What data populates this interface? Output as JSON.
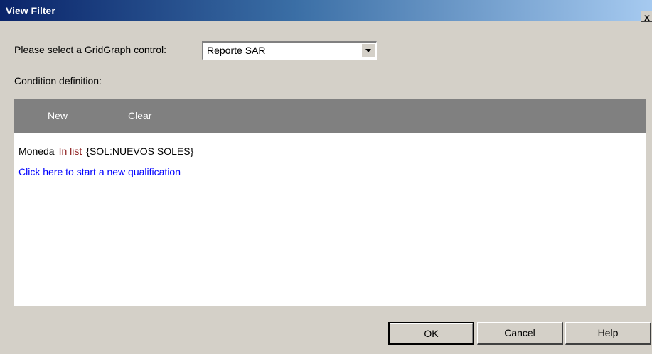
{
  "window": {
    "title": "View Filter",
    "close_symbol": "x"
  },
  "selector": {
    "label": "Please select a GridGraph control:",
    "selected_value": "Reporte SAR"
  },
  "condition_section": {
    "label": "Condition definition:",
    "toolbar": {
      "new_label": "New",
      "clear_label": "Clear"
    },
    "conditions": [
      {
        "field": "Moneda",
        "operator": "In list",
        "value": "{SOL:NUEVOS SOLES}"
      }
    ],
    "new_qualification_link": "Click here to start a new qualification",
    "colors": {
      "toolbar_bg": "#808080",
      "operator": "#8b1a1a",
      "link": "#0000ff"
    }
  },
  "buttons": {
    "ok_label": "OK",
    "cancel_label": "Cancel",
    "help_label": "Help"
  }
}
